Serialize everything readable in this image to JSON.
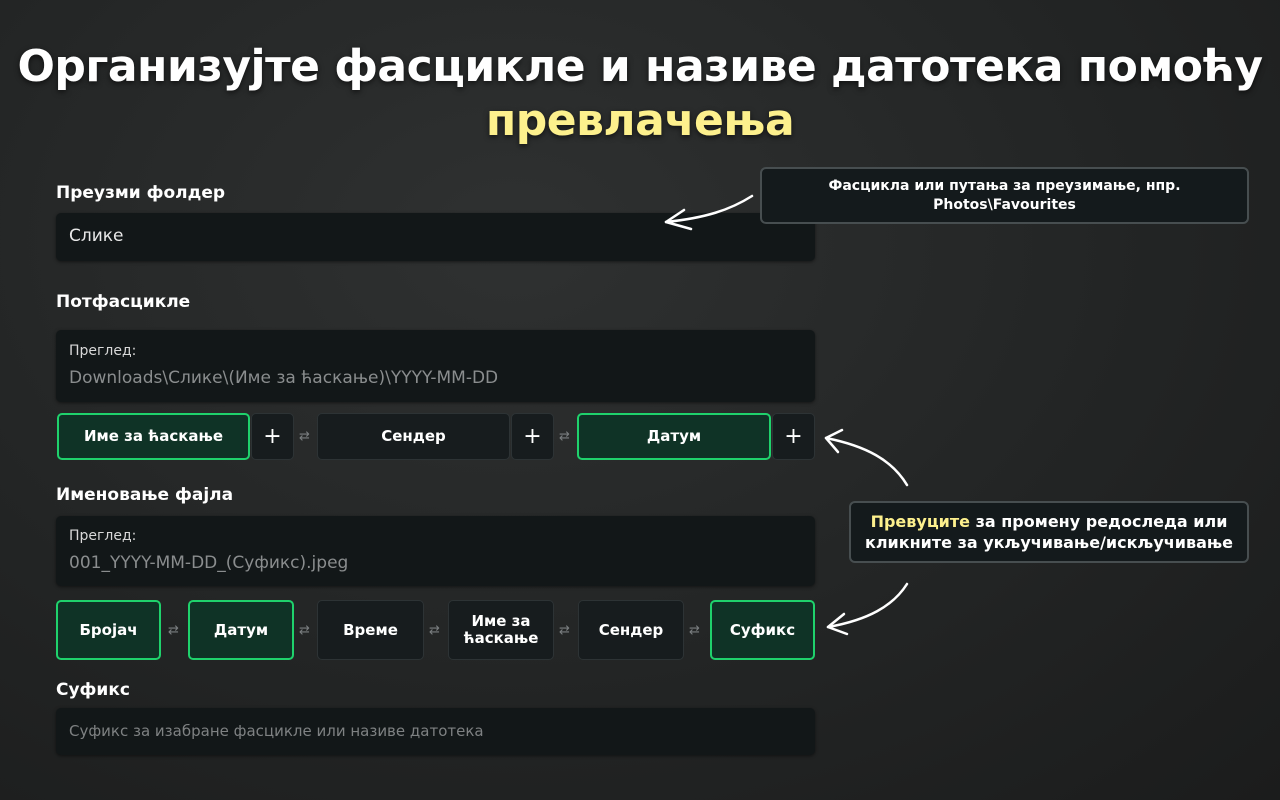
{
  "headline": {
    "line1": "Организујте фасцикле и називе датотека помоћу",
    "line2": "превлачења"
  },
  "download_folder": {
    "label": "Преузми фолдер",
    "value": "Слике"
  },
  "subfolders": {
    "label": "Потфасцикле",
    "preview_label": "Преглед:",
    "preview_value": "Downloads\\Слике\\(Име за ћаскање)\\YYYY-MM-DD",
    "chips": [
      {
        "label": "Име за ћаскање",
        "active": true
      },
      {
        "label": "Сендер",
        "active": false
      },
      {
        "label": "Датум",
        "active": true
      }
    ],
    "plus": "+",
    "swap": "⇄"
  },
  "file_naming": {
    "label": "Именовање фајла",
    "preview_label": "Преглед:",
    "preview_value": "001_YYYY-MM-DD_(Суфикс).jpeg",
    "chips": [
      {
        "label": "Бројач",
        "active": true
      },
      {
        "label": "Датум",
        "active": true
      },
      {
        "label": "Време",
        "active": false
      },
      {
        "label": "Име за ћаскање",
        "active": false
      },
      {
        "label": "Сендер",
        "active": false
      },
      {
        "label": "Суфикс",
        "active": true
      }
    ],
    "swap": "⇄"
  },
  "suffix": {
    "label": "Суфикс",
    "placeholder": "Суфикс за изабране фасцикле или називе датотека"
  },
  "callouts": {
    "folder_tip": {
      "line1": "Фасцикла или путања за преузимање, нпр.",
      "line2": "Photos\\Favourites"
    },
    "drag_tip": {
      "highlight": "Превуците",
      "rest1": " за промену редоследа или",
      "line2": "кликните за укључивање/искључивање"
    }
  },
  "colors": {
    "accent_green": "#1fd26c",
    "highlight_yellow": "#fdf08d"
  }
}
